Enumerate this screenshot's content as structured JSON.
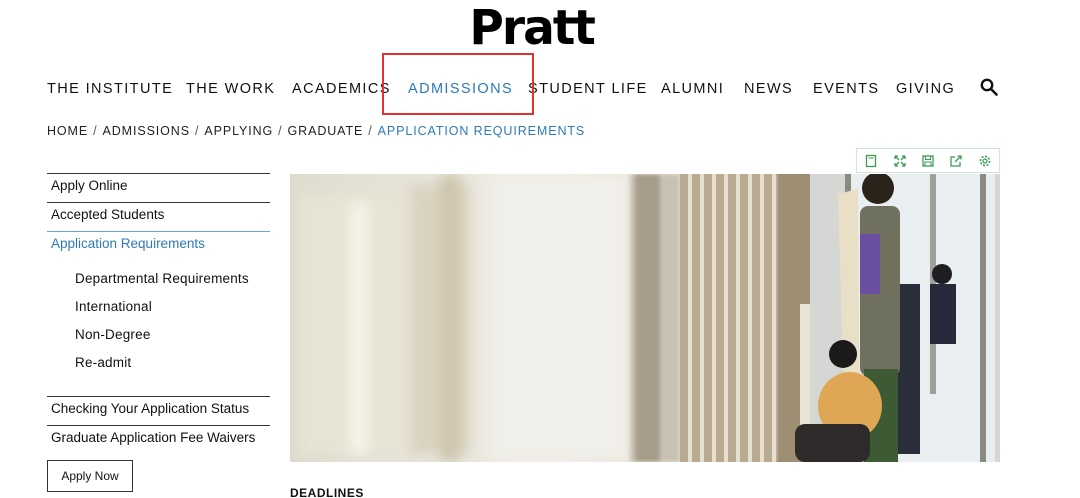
{
  "logo": {
    "text": "Pratt"
  },
  "nav": {
    "items": [
      {
        "label": "THE INSTITUTE"
      },
      {
        "label": "THE WORK"
      },
      {
        "label": "ACADEMICS"
      },
      {
        "label": "ADMISSIONS"
      },
      {
        "label": "STUDENT LIFE"
      },
      {
        "label": "ALUMNI"
      },
      {
        "label": "NEWS"
      },
      {
        "label": "EVENTS"
      },
      {
        "label": "GIVING"
      }
    ],
    "active": "ADMISSIONS"
  },
  "breadcrumb": {
    "items": [
      "HOME",
      "ADMISSIONS",
      "APPLYING",
      "GRADUATE"
    ],
    "current": "APPLICATION REQUIREMENTS",
    "separator": "/"
  },
  "toolbar": {
    "icons": [
      "page-icon",
      "expand-icon",
      "save-icon",
      "share-icon",
      "settings-icon"
    ],
    "color": "#3a9b57"
  },
  "sidebar": {
    "links": [
      {
        "label": "Apply Online"
      },
      {
        "label": "Accepted Students"
      },
      {
        "label": "Application Requirements"
      }
    ],
    "sub_links": [
      {
        "label": "Departmental Requirements"
      },
      {
        "label": "International"
      },
      {
        "label": "Non-Degree"
      },
      {
        "label": "Re-admit"
      }
    ],
    "bottom_links": [
      {
        "label": "Checking Your Application Status"
      },
      {
        "label": "Graduate Application Fee Waivers"
      }
    ],
    "apply_button": "Apply Now",
    "accent_color": "#2e7ab8"
  },
  "content": {
    "section_heading": "DEADLINES"
  }
}
